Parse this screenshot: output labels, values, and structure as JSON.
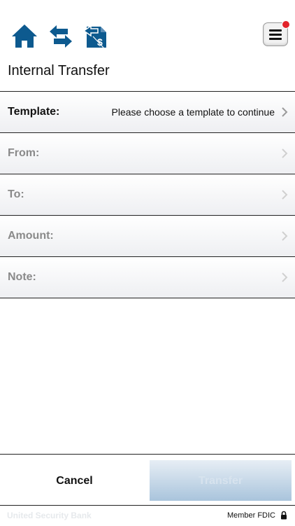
{
  "colors": {
    "brand_blue": "#0d5a8f",
    "badge_red": "#e2232a"
  },
  "nav": {
    "icons": [
      "home-icon",
      "transfer-arrows-icon",
      "payment-icon"
    ],
    "menu_icon": "hamburger-menu-icon"
  },
  "page": {
    "title": "Internal Transfer"
  },
  "form": {
    "template": {
      "label": "Template:",
      "value": "Please choose a template to continue"
    },
    "from": {
      "label": "From:"
    },
    "to": {
      "label": "To:"
    },
    "amount": {
      "label": "Amount:"
    },
    "note": {
      "label": "Note:"
    }
  },
  "footer": {
    "cancel_label": "Cancel",
    "transfer_label": "Transfer"
  },
  "statusbar": {
    "bank_name": "United Security Bank",
    "fdic": "Member FDIC",
    "lock_icon": "lock-icon"
  }
}
